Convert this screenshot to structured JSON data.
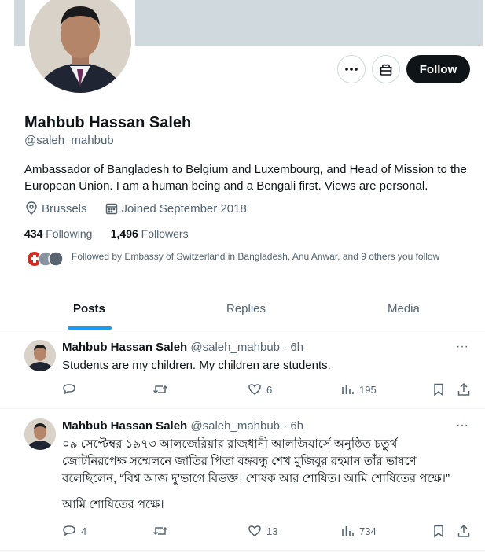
{
  "profile": {
    "name": "Mahbub Hassan Saleh",
    "handle": "@saleh_mahbub",
    "bio": "Ambassador of Bangladesh to Belgium and Luxembourg, and Head of Mission to the European Union. I am a human being and a Bengali first. Views are personal.",
    "location": "Brussels",
    "joined": "Joined September 2018",
    "following_count": "434",
    "following_label": "Following",
    "followers_count": "1,496",
    "followers_label": "Followers",
    "followed_by": "Followed by Embassy of Switzerland in Bangladesh, Anu Anwar, and 9 others you follow"
  },
  "actions": {
    "follow_label": "Follow",
    "more_icon": "more-icon",
    "subscribe_icon": "gift-icon"
  },
  "tabs": [
    {
      "label": "Posts"
    },
    {
      "label": "Replies"
    },
    {
      "label": "Media"
    }
  ],
  "tweets": [
    {
      "name": "Mahbub Hassan Saleh",
      "handle": "@saleh_mahbub · 6h",
      "text": "Students are my children. My children are students.",
      "replies": "",
      "retweets": "",
      "likes": "6",
      "views": "195"
    },
    {
      "name": "Mahbub Hassan Saleh",
      "handle": "@saleh_mahbub · 6h",
      "text": "০৯ সেপ্টেম্বর ১৯৭৩ আলজেরিয়ার রাজধানী আলজিয়ার্সে অনুষ্ঠিত চতুর্থ জোটনিরপেক্ষ সম্মেলনে জাতির পিতা বঙ্গবন্ধু শেখ মুজিবুর রহমান তাঁর ভাষণে বলেছিলেন, “বিশ্ব আজ দু’ভাগে বিভক্ত। শোষক আর শোষিত। আমি শোষিতের পক্ষে।”",
      "text2": "আমি শোষিতের পক্ষে।",
      "replies": "4",
      "retweets": "",
      "likes": "13",
      "views": "734"
    }
  ],
  "colors": {
    "accent": "#1d9bf0",
    "text": "#0f1419",
    "muted": "#536471",
    "banner": "#cfd9de"
  }
}
